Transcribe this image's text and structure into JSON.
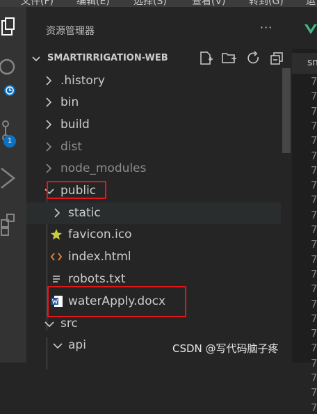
{
  "menubar": {
    "items": [
      "文件(F)",
      "编辑(E)",
      "选择(S)",
      "查看(V)",
      "转到(G)",
      "运"
    ]
  },
  "activity_bar": {
    "scm_badge": "1"
  },
  "sidebar": {
    "title": "资源管理器",
    "more": "···",
    "project_name": "SMARTIRRIGATION-WEB"
  },
  "tree": [
    {
      "label": ".history",
      "kind": "folder",
      "expanded": false,
      "dim": false
    },
    {
      "label": "bin",
      "kind": "folder",
      "expanded": false,
      "dim": false
    },
    {
      "label": "build",
      "kind": "folder",
      "expanded": false,
      "dim": false
    },
    {
      "label": "dist",
      "kind": "folder",
      "expanded": false,
      "dim": true
    },
    {
      "label": "node_modules",
      "kind": "folder",
      "expanded": false,
      "dim": true
    },
    {
      "label": "public",
      "kind": "folder",
      "expanded": true,
      "dim": false
    },
    {
      "label": "static",
      "kind": "folder",
      "expanded": false,
      "dim": false
    },
    {
      "label": "favicon.ico",
      "kind": "file",
      "icon": "star-icon"
    },
    {
      "label": "index.html",
      "kind": "file",
      "icon": "html-icon"
    },
    {
      "label": "robots.txt",
      "kind": "file",
      "icon": "text-file-icon"
    },
    {
      "label": "waterApply.docx",
      "kind": "file",
      "icon": "word-doc-icon"
    },
    {
      "label": "src",
      "kind": "folder",
      "expanded": true,
      "dim": false
    },
    {
      "label": "api",
      "kind": "folder",
      "expanded": true,
      "dim": false
    }
  ],
  "editor": {
    "tab_text": "sm",
    "line_numbers": [
      "7",
      "7",
      "7",
      "7",
      "7",
      "7",
      "7",
      "7",
      "7",
      "7",
      "7",
      "7",
      "7",
      "7",
      "7",
      "7",
      "7",
      "7",
      "7",
      "7",
      "7",
      "7",
      "7"
    ]
  },
  "colors": {
    "highlight_box": "#e8141c",
    "accent": "#0e70c0"
  },
  "watermark": "CSDN @写代码脑子疼"
}
